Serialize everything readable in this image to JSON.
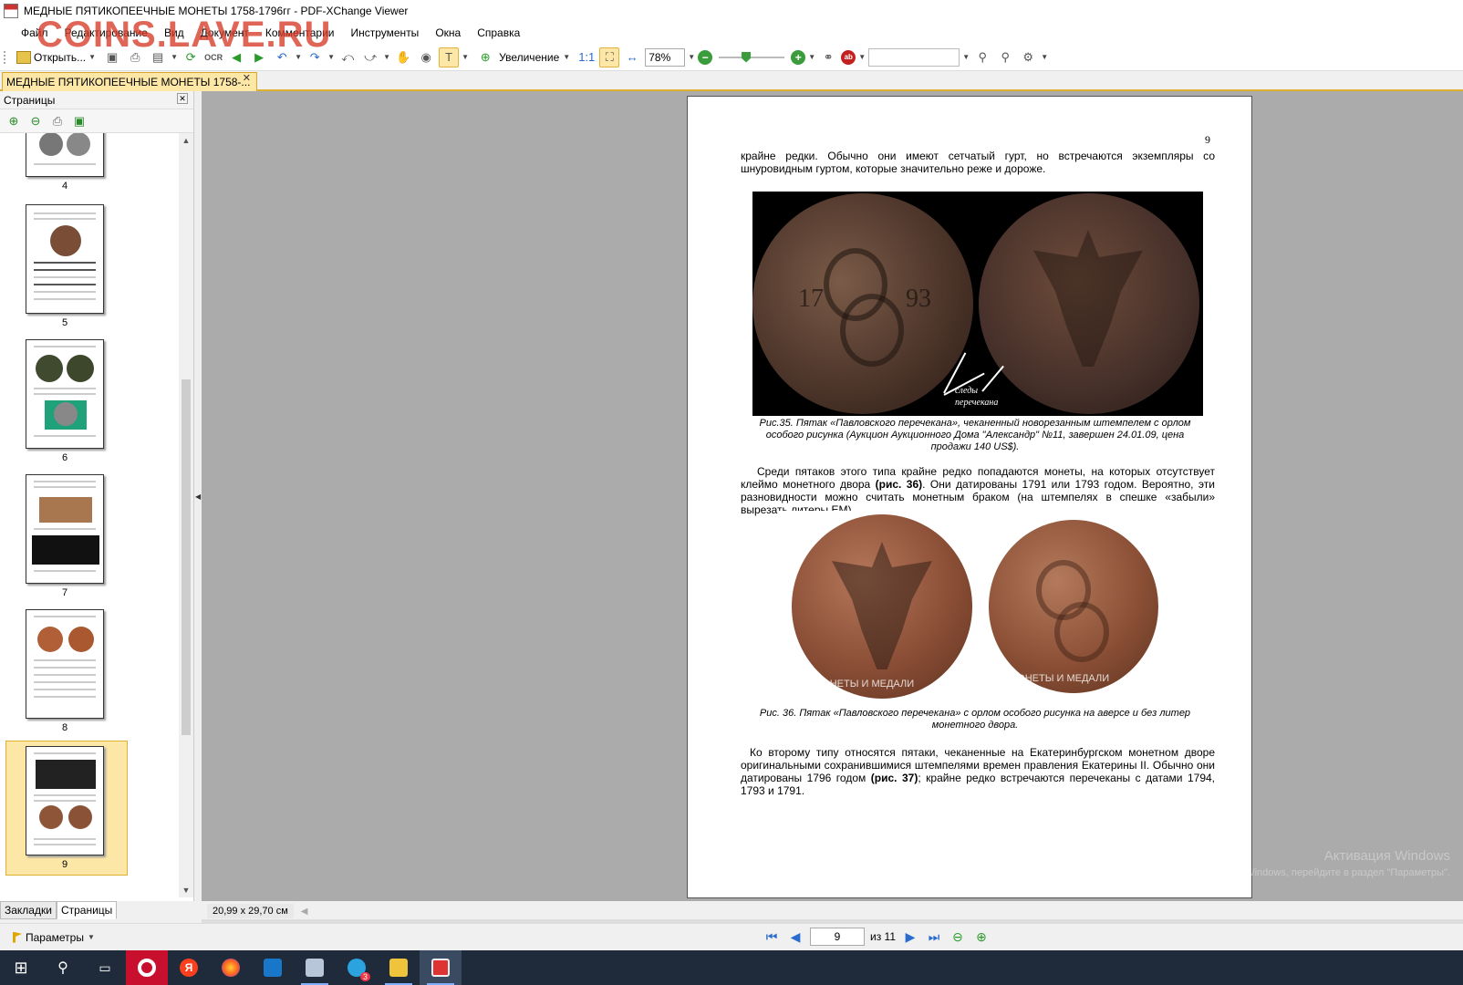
{
  "window": {
    "title": "МЕДНЫЕ ПЯТИКОПЕЕЧНЫЕ МОНЕТЫ 1758-1796гг - PDF-XChange Viewer",
    "watermark": "COINS.LAVE.RU"
  },
  "menu": [
    "Файл",
    "Редактирование",
    "Вид",
    "Документ",
    "Комментарии",
    "Инструменты",
    "Окна",
    "Справка"
  ],
  "toolbar": {
    "open_label": "Открыть...",
    "ocr_label": "OCR",
    "zoom_label": "Увеличение",
    "zoom_value": "78%",
    "zoom_slider_level_percent": 40
  },
  "document_tab": {
    "label": "МЕДНЫЕ ПЯТИКОПЕЕЧНЫЕ МОНЕТЫ 1758-..."
  },
  "left_panel": {
    "title": "Страницы",
    "thumbnails": [
      "4",
      "5",
      "6",
      "7",
      "8",
      "9"
    ],
    "selected": "9",
    "tabs": [
      "Закладки",
      "Страницы"
    ],
    "active_tab": "Страницы"
  },
  "page": {
    "number": "9",
    "para1": "крайне редки. Обычно они имеют сетчатый гурт, но встречаются экземпляры со шнуровидным гуртом, которые значительно реже и дороже.",
    "figure1_label": "следы перечекана",
    "figure1_year_left": "17",
    "figure1_year_right": "93",
    "caption1": "Рис.35. Пятак «Павловского перечекана», чеканенный новорезанным штемпелем с орлом особого рисунка (Аукцион Аукционного Дома \"Александр\" №11, завершен 24.01.09, цена продажи 140 US$).",
    "para2_a": "Среди пятаков этого типа крайне редко попадаются монеты, на которых отсутствует клеймо монетного двора ",
    "para2_ref": "(рис. 36)",
    "para2_b": ". Они датированы 1791 или 1793 годом. Вероятно, эти разновидности можно считать монетным браком (на штемпелях в спешке «забыли» вырезать литеры ЕМ).",
    "figure2_watermark": "МОНЕТЫ И МЕДАЛИ",
    "caption2": "Рис. 36. Пятак «Павловского перечекана» с орлом особого рисунка на аверсе и без литер монетного двора.",
    "para3_a": "Ко второму типу относятся пятаки, чеканенные на Екатеринбургском монетном дворе оригинальными сохранившимися штемпелями времен правления Екатерины II. Обычно они датированы 1796 годом ",
    "para3_ref": "(рис. 37)",
    "para3_b": "; крайне редко встречаются перечеканы с датами 1794, 1793 и 1791.",
    "activation_line1": "Активация Windows",
    "activation_line2": "Чтобы активировать Windows, перейдите в раздел \"Параметры\"."
  },
  "status": {
    "page_size": "20,99 x 29,70 см"
  },
  "navigation": {
    "params_label": "Параметры",
    "current_page": "9",
    "total_label": "из 11"
  },
  "taskbar": {
    "items": [
      "start-icon",
      "search-icon",
      "task-view-icon",
      "opera-icon",
      "yandex-icon",
      "firefox-icon",
      "outlook-icon",
      "scanner-icon",
      "telegram-icon",
      "explorer-icon",
      "pdf-xchange-icon"
    ],
    "telegram_badge": "3"
  },
  "colors": {
    "accent_tab": "#fde7a6",
    "accent_border": "#e0b030",
    "viewport_bg": "#ababab",
    "taskbar_bg": "#1f2a3a",
    "watermark": "#d63a28"
  }
}
